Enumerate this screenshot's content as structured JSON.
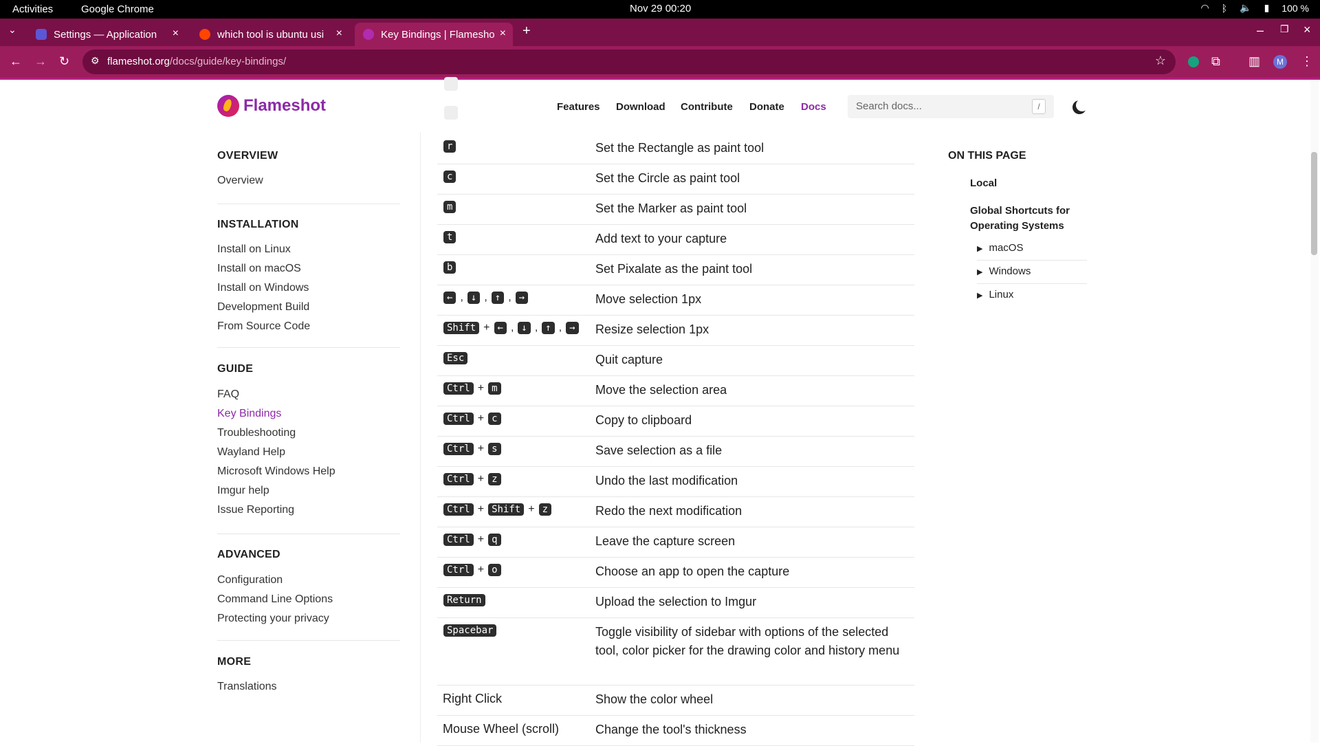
{
  "system": {
    "activities": "Activities",
    "app_name": "Google Chrome",
    "datetime": "Nov 29  00:20",
    "battery": "100 %"
  },
  "browser": {
    "tabs": [
      {
        "title": "Settings — Application",
        "favicon_color": "#5b57d6",
        "active": false
      },
      {
        "title": "which tool is ubuntu usi",
        "favicon_color": "#ff4500",
        "active": false
      },
      {
        "title": "Key Bindings | Flamesho",
        "favicon_color": "#b02cb0",
        "active": true
      }
    ],
    "url_host": "flameshot.org",
    "url_path": "/docs/guide/key-bindings/"
  },
  "site": {
    "logo_text": "Flameshot",
    "nav": [
      "Features",
      "Download",
      "Contribute",
      "Donate",
      "Docs"
    ],
    "search_placeholder": "Search docs...",
    "search_key": "/"
  },
  "sidebar": {
    "sections": [
      {
        "title": "OVERVIEW",
        "items": [
          "Overview"
        ]
      },
      {
        "title": "INSTALLATION",
        "items": [
          "Install on Linux",
          "Install on macOS",
          "Install on Windows",
          "Development Build",
          "From Source Code"
        ]
      },
      {
        "title": "GUIDE",
        "items": [
          "FAQ",
          "Key Bindings",
          "Troubleshooting",
          "Wayland Help",
          "Microsoft Windows Help",
          "Imgur help",
          "Issue Reporting"
        ]
      },
      {
        "title": "ADVANCED",
        "items": [
          "Configuration",
          "Command Line Options",
          "Protecting your privacy"
        ]
      },
      {
        "title": "MORE",
        "items": [
          "Translations"
        ]
      }
    ],
    "current": "Key Bindings"
  },
  "bindings": [
    {
      "keys": [
        "r"
      ],
      "description": "Set the Rectangle as paint tool"
    },
    {
      "keys": [
        "c"
      ],
      "description": "Set the Circle as paint tool"
    },
    {
      "keys": [
        "m"
      ],
      "description": "Set the Marker as paint tool"
    },
    {
      "keys": [
        "t"
      ],
      "description": "Add text to your capture"
    },
    {
      "keys": [
        "b"
      ],
      "description": "Set Pixalate as the paint tool"
    },
    {
      "keys": [
        "←",
        ",",
        "↓",
        ",",
        "↑",
        ",",
        "→"
      ],
      "description": "Move selection 1px"
    },
    {
      "keys": [
        "Shift",
        "+",
        "←",
        ",",
        "↓",
        ",",
        "↑",
        ",",
        "→"
      ],
      "description": "Resize selection 1px"
    },
    {
      "keys": [
        "Esc"
      ],
      "description": "Quit capture"
    },
    {
      "keys": [
        "Ctrl",
        "+",
        "m"
      ],
      "description": "Move the selection area"
    },
    {
      "keys": [
        "Ctrl",
        "+",
        "c"
      ],
      "description": "Copy to clipboard"
    },
    {
      "keys": [
        "Ctrl",
        "+",
        "s"
      ],
      "description": "Save selection as a file"
    },
    {
      "keys": [
        "Ctrl",
        "+",
        "z"
      ],
      "description": "Undo the last modification"
    },
    {
      "keys": [
        "Ctrl",
        "+",
        "Shift",
        "+",
        "z"
      ],
      "description": "Redo the next modification"
    },
    {
      "keys": [
        "Ctrl",
        "+",
        "q"
      ],
      "description": "Leave the capture screen"
    },
    {
      "keys": [
        "Ctrl",
        "+",
        "o"
      ],
      "description": "Choose an app to open the capture"
    },
    {
      "keys": [
        "Return"
      ],
      "description": "Upload the selection to Imgur"
    },
    {
      "keys": [
        "Spacebar"
      ],
      "description": "Toggle visibility of sidebar with options of the selected tool, color picker for the drawing color and history menu"
    },
    {
      "plain": "Right Click",
      "description": "Show the color wheel"
    },
    {
      "plain": "Mouse Wheel (scroll)",
      "description": "Change the tool's thickness"
    }
  ],
  "toc": {
    "title": "ON THIS PAGE",
    "items": [
      "Local",
      "Global Shortcuts for Operating Systems"
    ],
    "subitems": [
      "macOS",
      "Windows",
      "Linux"
    ]
  },
  "colors": {
    "accent": "#8d2aa8",
    "browser_frame": "#9c1d5c",
    "tabbar": "#7a1048"
  }
}
